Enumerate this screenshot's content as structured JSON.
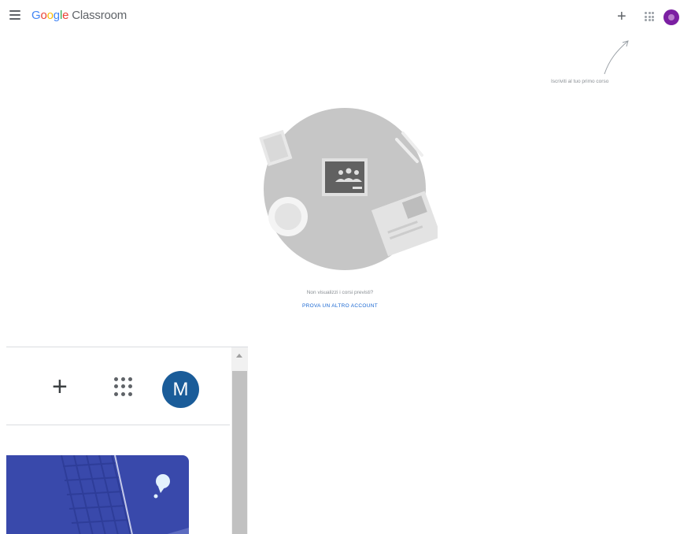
{
  "app": {
    "logo_google": "Google",
    "logo_product": "Classroom"
  },
  "header": {
    "create_join_label": "+",
    "apps_icon": "apps-grid-icon",
    "menu_icon": "hamburger-menu-icon",
    "avatar_color": "#7b1fa2"
  },
  "hint": {
    "text": "Iscriviti al tuo primo corso"
  },
  "empty_state": {
    "message": "Non visualizzi i corsi previsti?",
    "link_label": "PROVA UN ALTRO ACCOUNT"
  },
  "zoom": {
    "plus_label": "+",
    "avatar_initial": "M",
    "avatar_color": "#1a5c99",
    "card_color": "#3949ab"
  }
}
